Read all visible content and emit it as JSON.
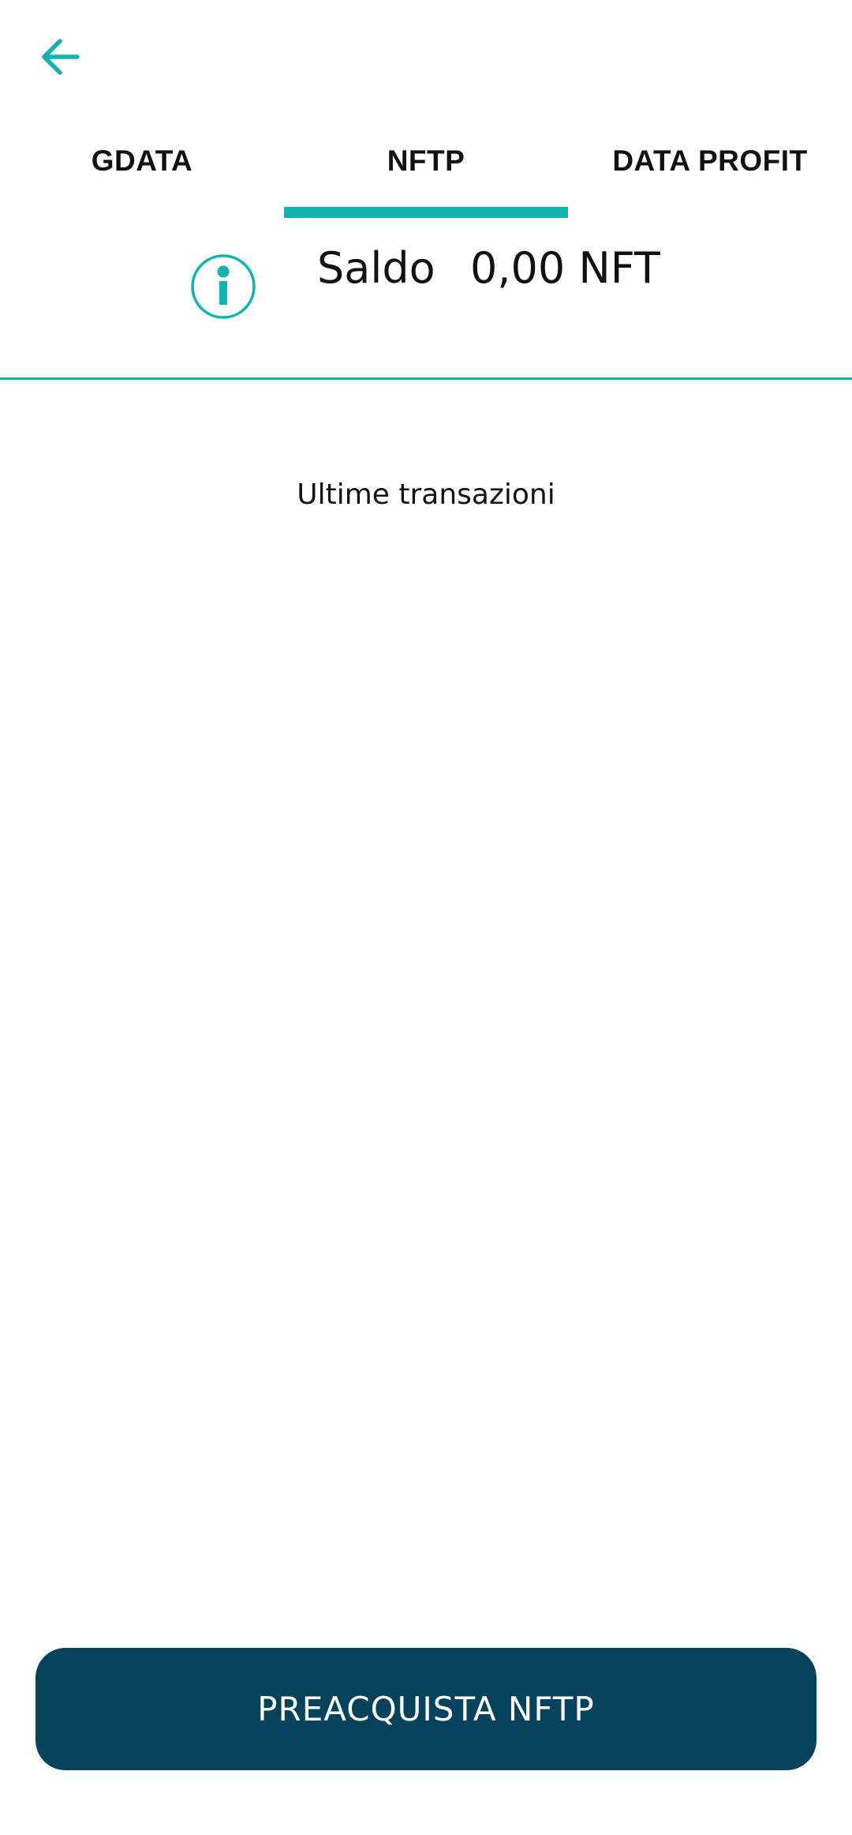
{
  "header": {
    "back_icon": "arrow-left-icon"
  },
  "tabs": [
    {
      "label": "GDATA",
      "selected": false
    },
    {
      "label": "NFTP",
      "selected": true
    },
    {
      "label": "DATA PROFIT",
      "selected": false
    }
  ],
  "balance": {
    "info_icon": "info-icon",
    "label": "Saldo",
    "value": "0,00 NFT"
  },
  "transactions": {
    "title": "Ultime transazioni"
  },
  "footer": {
    "button_label": "PREACQUISTA NFTP"
  },
  "colors": {
    "accent": "#10b3b0",
    "button_bg": "#05425c"
  }
}
